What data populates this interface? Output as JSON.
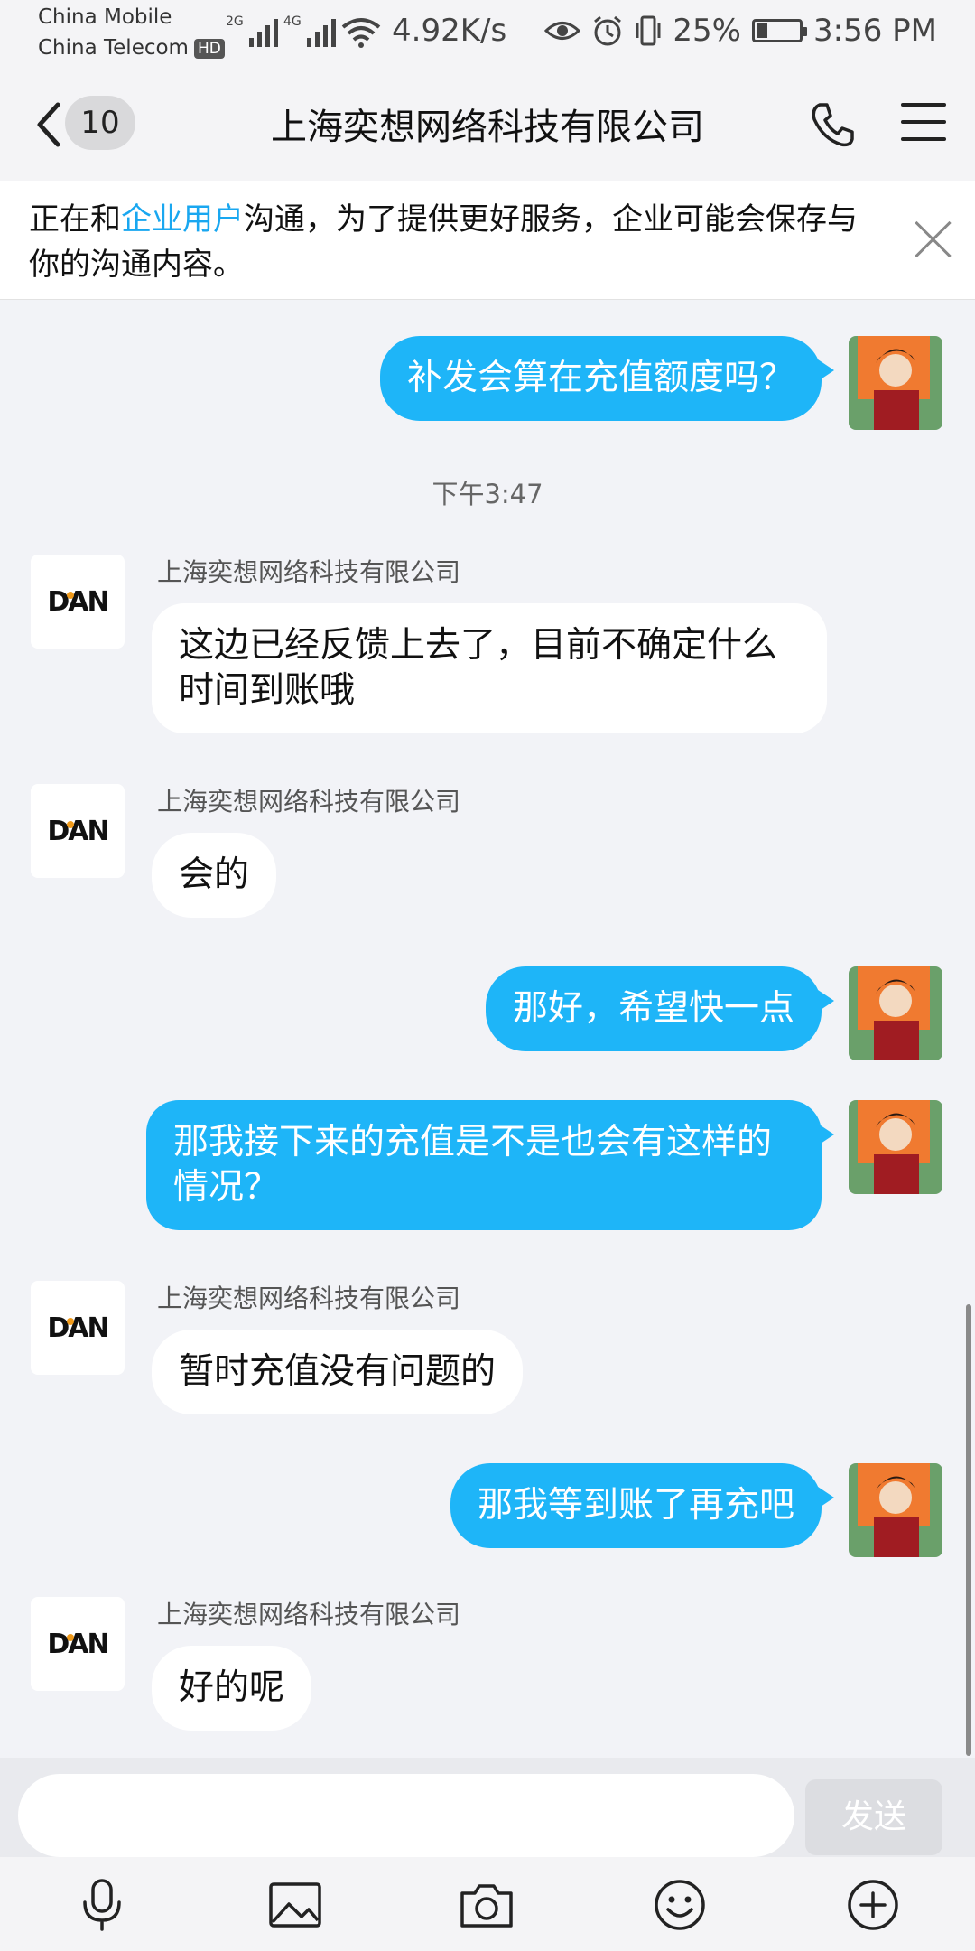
{
  "status_bar": {
    "carrier1": "China Mobile",
    "carrier2": "China Telecom",
    "hd": "HD",
    "net1": "2G",
    "net2": "4G",
    "speed": "4.92K/s",
    "battery": "25%",
    "battery_level": 0.25,
    "time": "3:56 PM"
  },
  "header": {
    "unread_count": "10",
    "title": "上海奕想网络科技有限公司"
  },
  "notice": {
    "text_before": "正在和",
    "link": "企业用户",
    "text_after": "沟通，为了提供更好服务，企业可能会保存与你的沟通内容。"
  },
  "messages": [
    {
      "from": "me",
      "text": "补发会算在充值额度吗？"
    },
    {
      "type": "time",
      "text": "下午3:47"
    },
    {
      "from": "them",
      "sender": "上海奕想网络科技有限公司",
      "text": "这边已经反馈上去了，目前不确定什么时间到账哦",
      "logo": "DAN"
    },
    {
      "from": "them",
      "sender": "上海奕想网络科技有限公司",
      "text": "会的",
      "logo": "DAN"
    },
    {
      "from": "me",
      "text": "那好，希望快一点"
    },
    {
      "from": "me",
      "text": "那我接下来的充值是不是也会有这样的情况？"
    },
    {
      "from": "them",
      "sender": "上海奕想网络科技有限公司",
      "text": "暂时充值没有问题的",
      "logo": "DAN"
    },
    {
      "from": "me",
      "text": "那我等到账了再充吧"
    },
    {
      "from": "them",
      "sender": "上海奕想网络科技有限公司",
      "text": "好的呢",
      "logo": "DAN"
    }
  ],
  "input": {
    "value": "",
    "send_label": "发送"
  },
  "toolbar": {
    "icons": [
      "microphone-icon",
      "image-icon",
      "camera-icon",
      "emoji-icon",
      "plus-icon"
    ]
  },
  "colors": {
    "my_bubble": "#1eb5f8",
    "link": "#19a7f0"
  }
}
